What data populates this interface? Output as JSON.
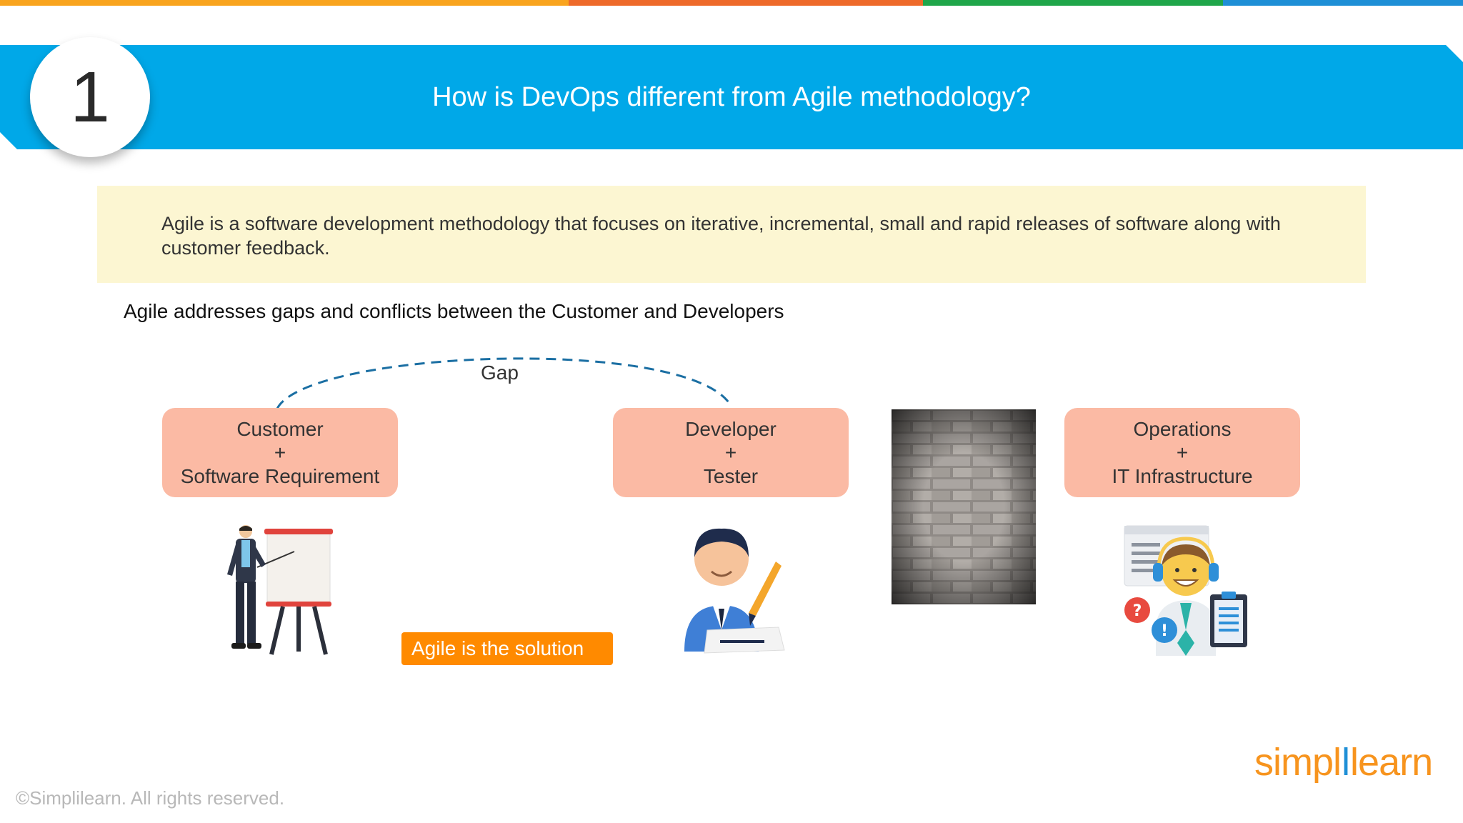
{
  "colors": {
    "stripes": [
      "#f9a41e",
      "#ee6a2a",
      "#1fa64a",
      "#1e8fd6"
    ],
    "banner": "#00a8e8",
    "definition_bg": "#fcf6d2",
    "role_box": "#fbbaa4",
    "solution": "#ff8a00",
    "logo": "#f7941e"
  },
  "slide": {
    "number": "1",
    "title": "How is DevOps different from Agile methodology?"
  },
  "definition": "Agile is a software development methodology that focuses on iterative, incremental, small and rapid releases of software along with customer feedback.",
  "subtitle": "Agile addresses gaps and conflicts between the Customer and Developers",
  "diagram": {
    "gap_label": "Gap",
    "customer": {
      "line1": "Customer",
      "plus": "+",
      "line2": "Software Requirement"
    },
    "developer": {
      "line1": "Developer",
      "plus": "+",
      "line2": "Tester"
    },
    "operations": {
      "line1": "Operations",
      "plus": "+",
      "line2": "IT Infrastructure"
    },
    "solution_label": "Agile is the solution"
  },
  "icons": [
    "presenter-icon",
    "developer-icon",
    "brick-wall-icon",
    "support-agent-icon"
  ],
  "footer": {
    "copyright": "©Simplilearn. All rights reserved.",
    "logo_left": "simpl",
    "logo_right": "learn"
  }
}
